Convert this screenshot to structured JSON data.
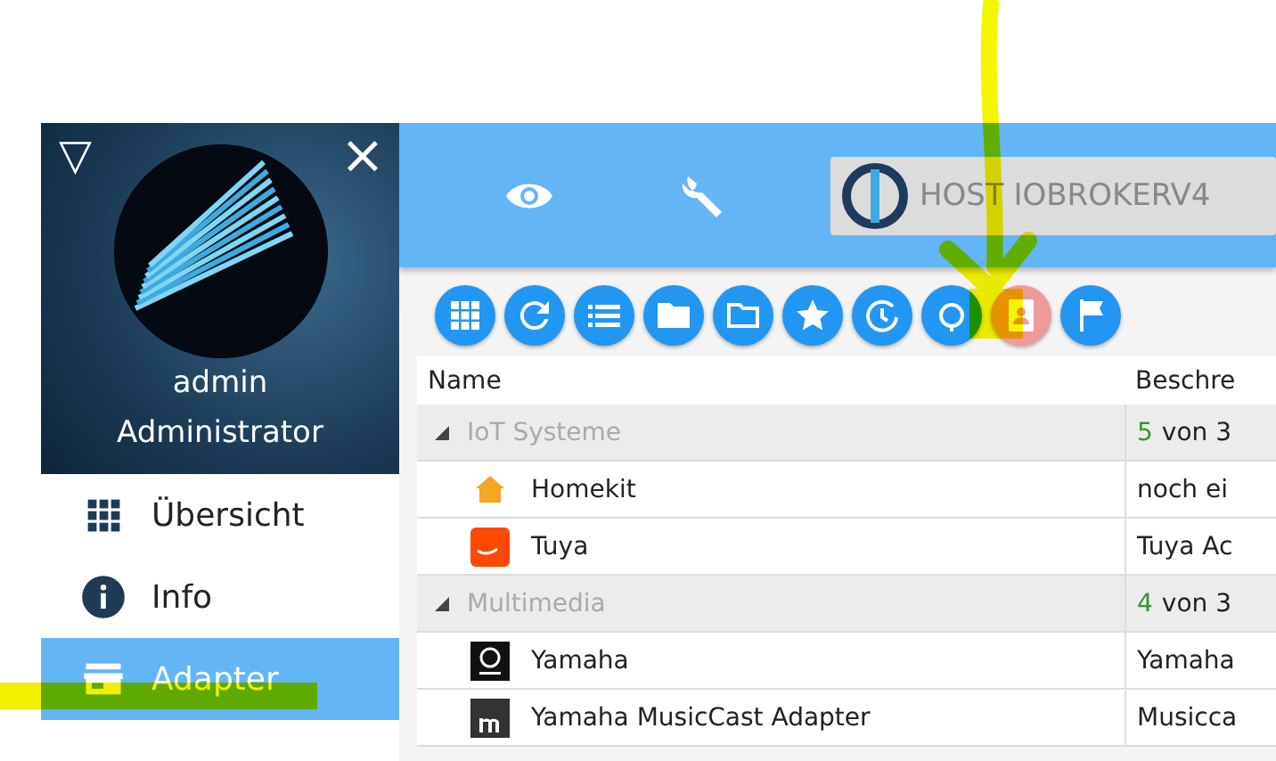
{
  "sidebar": {
    "expand_icon": "▽",
    "close_icon": "×",
    "user": "admin",
    "role": "Administrator",
    "items": [
      {
        "label": "Übersicht",
        "selected": false
      },
      {
        "label": "Info",
        "selected": false
      },
      {
        "label": "Adapter",
        "selected": true
      }
    ]
  },
  "header": {
    "host": "HOST IOBROKERV4"
  },
  "toolbar": [
    {
      "color": "#2196f3"
    },
    {
      "color": "#2196f3"
    },
    {
      "color": "#2196f3"
    },
    {
      "color": "#2196f3"
    },
    {
      "color": "#2196f3"
    },
    {
      "color": "#2196f3"
    },
    {
      "color": "#2196f3"
    },
    {
      "color": "#2196f3"
    },
    {
      "color": "#ef9a9a"
    },
    {
      "color": "#2196f3"
    }
  ],
  "table": {
    "columns": [
      "Name",
      "Beschre"
    ],
    "rows": [
      {
        "kind": "group",
        "name": "IoT Systeme",
        "count": "5",
        "description": "von 3"
      },
      {
        "kind": "adapter",
        "name": "Homekit",
        "description": "noch ei"
      },
      {
        "kind": "adapter",
        "name": "Tuya",
        "description": "Tuya Ac"
      },
      {
        "kind": "group",
        "name": "Multimedia",
        "count": "4",
        "description": "von 3"
      },
      {
        "kind": "adapter",
        "name": "Yamaha",
        "description": "Yamaha"
      },
      {
        "kind": "adapter",
        "name": "Yamaha MusicCast Adapter",
        "description": "Musicca"
      }
    ]
  }
}
